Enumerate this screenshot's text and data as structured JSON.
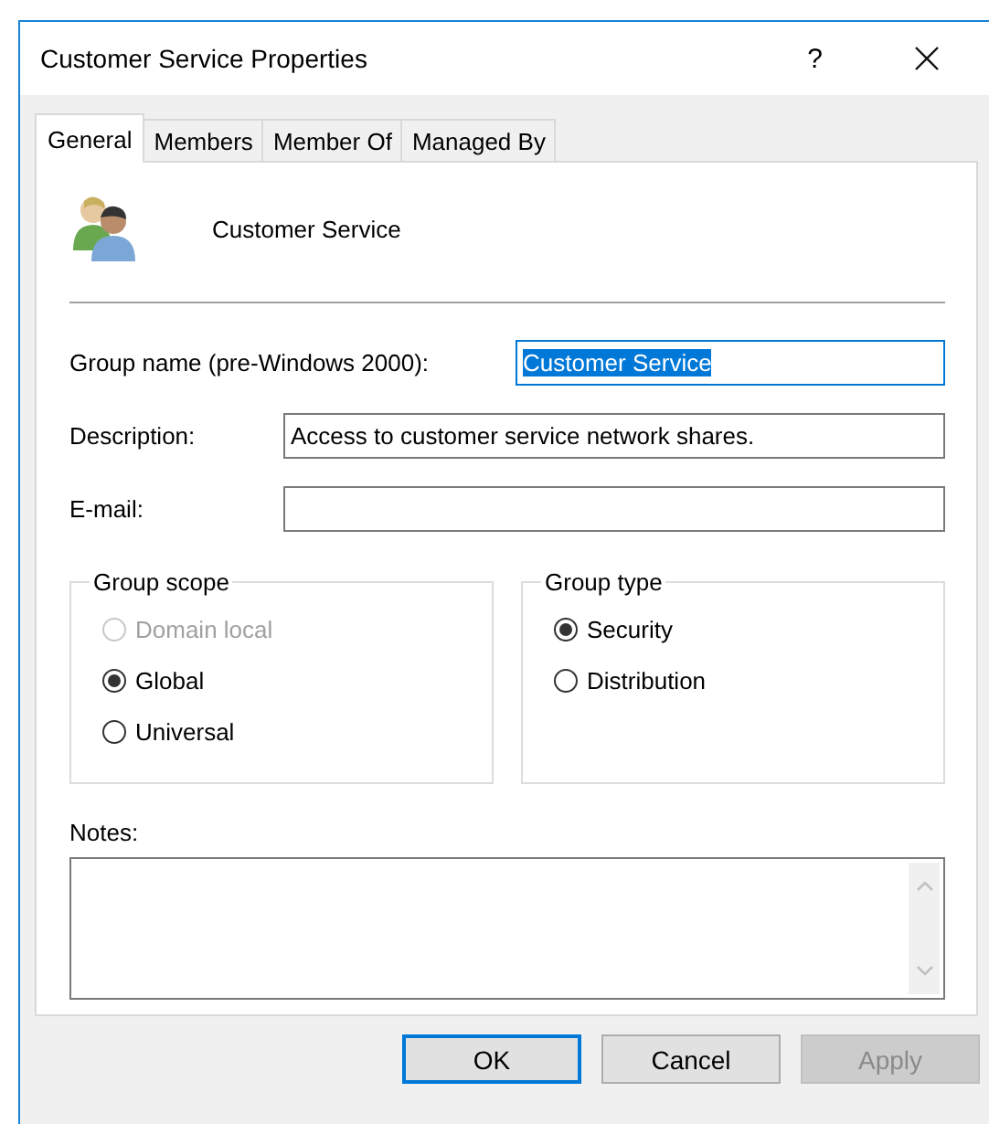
{
  "window": {
    "title": "Customer Service Properties",
    "help_button": "?"
  },
  "tabs": [
    {
      "label": "General",
      "selected": true
    },
    {
      "label": "Members",
      "selected": false
    },
    {
      "label": "Member Of",
      "selected": false
    },
    {
      "label": "Managed By",
      "selected": false
    }
  ],
  "header": {
    "name": "Customer Service"
  },
  "fields": [
    {
      "label": "Group name (pre-Windows 2000):",
      "value": "Customer Service",
      "focused": true
    },
    {
      "label": "Description:",
      "value": "Access to customer service network shares.",
      "focused": false
    },
    {
      "label": "E-mail:",
      "focused": false
    }
  ],
  "group_scope": {
    "title": "Group scope",
    "options": [
      {
        "label": "Domain local",
        "selected": false,
        "disabled": true
      },
      {
        "label": "Global",
        "selected": true,
        "disabled": false
      },
      {
        "label": "Universal",
        "selected": false,
        "disabled": false
      }
    ]
  },
  "group_type": {
    "title": "Group type",
    "options": [
      {
        "label": "Security",
        "selected": true,
        "disabled": false
      },
      {
        "label": "Distribution",
        "selected": false,
        "disabled": false
      }
    ]
  },
  "notes": {
    "label": "Notes:"
  },
  "buttons": [
    {
      "label": "OK",
      "default": true,
      "disabled": false
    },
    {
      "label": "Cancel",
      "default": false,
      "disabled": false
    },
    {
      "label": "Apply",
      "default": false,
      "disabled": true
    }
  ]
}
